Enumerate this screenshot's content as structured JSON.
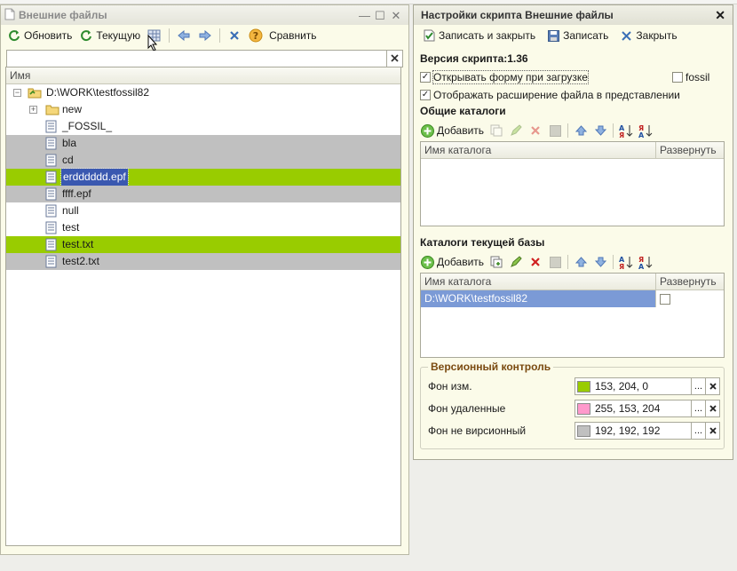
{
  "left_window": {
    "title": "Внешние файлы",
    "toolbar": {
      "refresh_label": "Обновить",
      "current_label": "Текущую",
      "compare_label": "Сравнить"
    },
    "search": {
      "value": "",
      "placeholder": ""
    },
    "tree": {
      "column_header": "Имя",
      "items": [
        {
          "label": "D:\\WORK\\testfossil82",
          "kind": "root",
          "bg": ""
        },
        {
          "label": "new",
          "kind": "folder",
          "bg": ""
        },
        {
          "label": "_FOSSIL_",
          "kind": "file",
          "bg": ""
        },
        {
          "label": "bla",
          "kind": "file",
          "bg": "#c0c0c0"
        },
        {
          "label": "cd",
          "kind": "file",
          "bg": "#c0c0c0"
        },
        {
          "label": "erdddddd.epf",
          "kind": "file",
          "bg": "#99cc00",
          "selected": true
        },
        {
          "label": "ffff.epf",
          "kind": "file",
          "bg": "#c0c0c0"
        },
        {
          "label": "null",
          "kind": "file",
          "bg": ""
        },
        {
          "label": "test",
          "kind": "file",
          "bg": ""
        },
        {
          "label": "test.txt",
          "kind": "file",
          "bg": "#99cc00"
        },
        {
          "label": "test2.txt",
          "kind": "file",
          "bg": "#c0c0c0"
        }
      ]
    }
  },
  "right_window": {
    "title": "Настройки скрипта Внешние файлы",
    "toolbar": {
      "save_close_label": "Записать и закрыть",
      "save_label": "Записать",
      "close_label": "Закрыть"
    },
    "version": "Версия скрипта:1.36",
    "open_on_load": {
      "label": "Открывать форму при загрузке",
      "checked": true
    },
    "fossil": {
      "label": "fossil",
      "checked": false
    },
    "show_ext": {
      "label": "Отображать расширение файла в представлении",
      "checked": true
    },
    "common_catalogs": {
      "title": "Общие каталоги",
      "add_label": "Добавить",
      "col_name": "Имя каталога",
      "col_expand": "Развернуть",
      "rows": []
    },
    "base_catalogs": {
      "title": "Каталоги текущей базы",
      "add_label": "Добавить",
      "col_name": "Имя каталога",
      "col_expand": "Развернуть",
      "rows": [
        {
          "name": "D:\\WORK\\testfossil82",
          "expand": false
        }
      ]
    },
    "version_control": {
      "title": "Версионный контроль",
      "changed": {
        "label": "Фон изм.",
        "value": "153, 204, 0",
        "color": "#99cc00"
      },
      "deleted": {
        "label": "Фон удаленные",
        "value": "255, 153, 204",
        "color": "#ff99cc"
      },
      "unversioned": {
        "label": "Фон не вирсионный",
        "value": "192, 192, 192",
        "color": "#c0c0c0"
      }
    }
  }
}
